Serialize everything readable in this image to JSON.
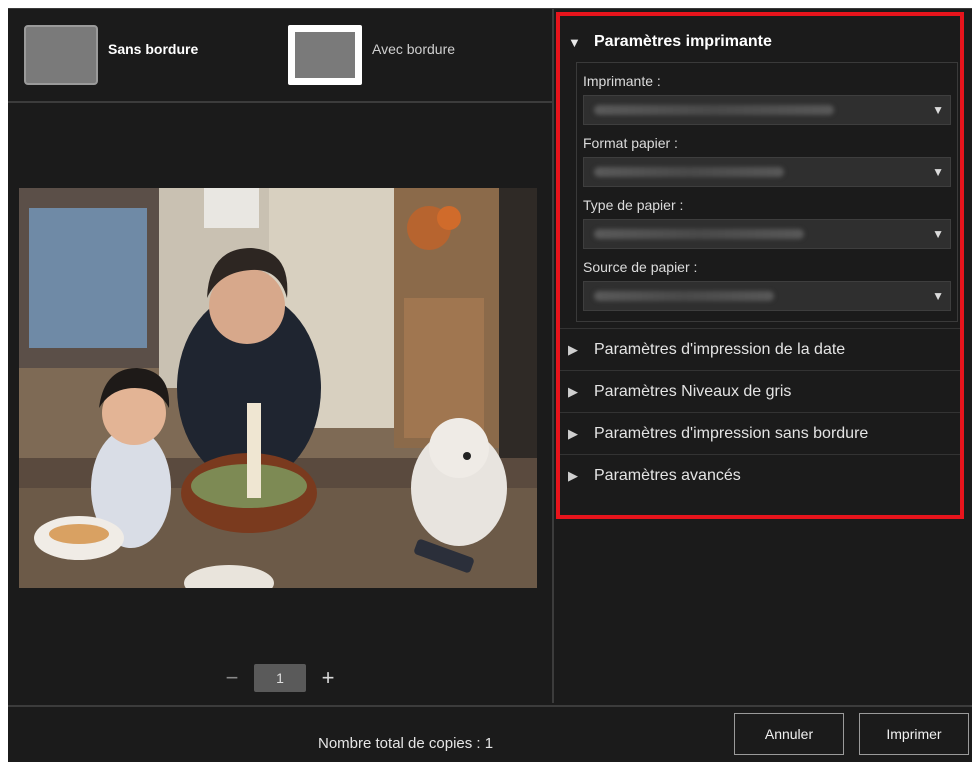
{
  "layout_options": {
    "borderless_label": "Sans bordure",
    "bordered_label": "Avec bordure"
  },
  "preview": {
    "copies_minus": "−",
    "copies_value": "1",
    "copies_plus": "+"
  },
  "printer_settings": {
    "title": "Paramètres imprimante",
    "fields": [
      {
        "label": "Imprimante :"
      },
      {
        "label": "Format papier :"
      },
      {
        "label": "Type de papier :"
      },
      {
        "label": "Source de papier :"
      }
    ],
    "sections": [
      {
        "label": "Paramètres d'impression de la date"
      },
      {
        "label": "Paramètres Niveaux de gris"
      },
      {
        "label": "Paramètres d'impression sans bordure"
      },
      {
        "label": "Paramètres avancés"
      }
    ]
  },
  "footer": {
    "total_copies": "Nombre total de copies : 1",
    "cancel": "Annuler",
    "print": "Imprimer"
  }
}
